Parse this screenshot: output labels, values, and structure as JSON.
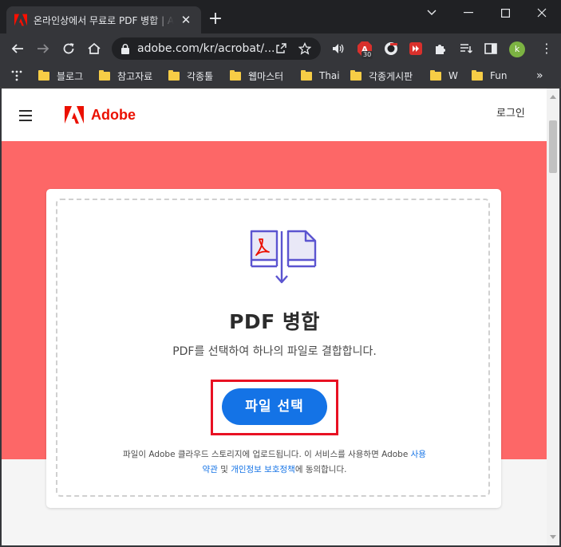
{
  "browser": {
    "tab_title": "온라인상에서 무료로 PDF 병합 | Adobe Acrobat",
    "tab_close": "✕",
    "new_tab": "+",
    "url": "adobe.com/kr/acrobat/...",
    "extension_badge": "30",
    "profile_initial": "k",
    "menu": "⋮"
  },
  "bookmarks": {
    "items": [
      {
        "label": "블로그"
      },
      {
        "label": "참고자료"
      },
      {
        "label": "각종툴"
      },
      {
        "label": "웹마스터"
      },
      {
        "label": "Thai"
      },
      {
        "label": "각종게시판"
      },
      {
        "label": "W"
      },
      {
        "label": "Fun"
      }
    ],
    "more": "»"
  },
  "site_header": {
    "brand": "Adobe",
    "login": "로그인"
  },
  "main": {
    "title": "PDF 병합",
    "subtitle": "PDF를 선택하여 하나의 파일로 결합합니다.",
    "select_button": "파일 선택",
    "legal": {
      "line1_prefix": "파일이 Adobe 클라우드 스토리지에 업로드됩니다. 이 서비스를 사용하면 Adobe ",
      "terms_part1": "사용",
      "terms_part2": "약관",
      "conjunction": " 및 ",
      "privacy_link": "개인정보 보호정책",
      "suffix": "에 동의합니다."
    }
  },
  "colors": {
    "hero_bg": "#fd6767",
    "primary_button": "#1473e6",
    "adobe_red": "#eb1000",
    "highlight_border": "#e81123"
  }
}
